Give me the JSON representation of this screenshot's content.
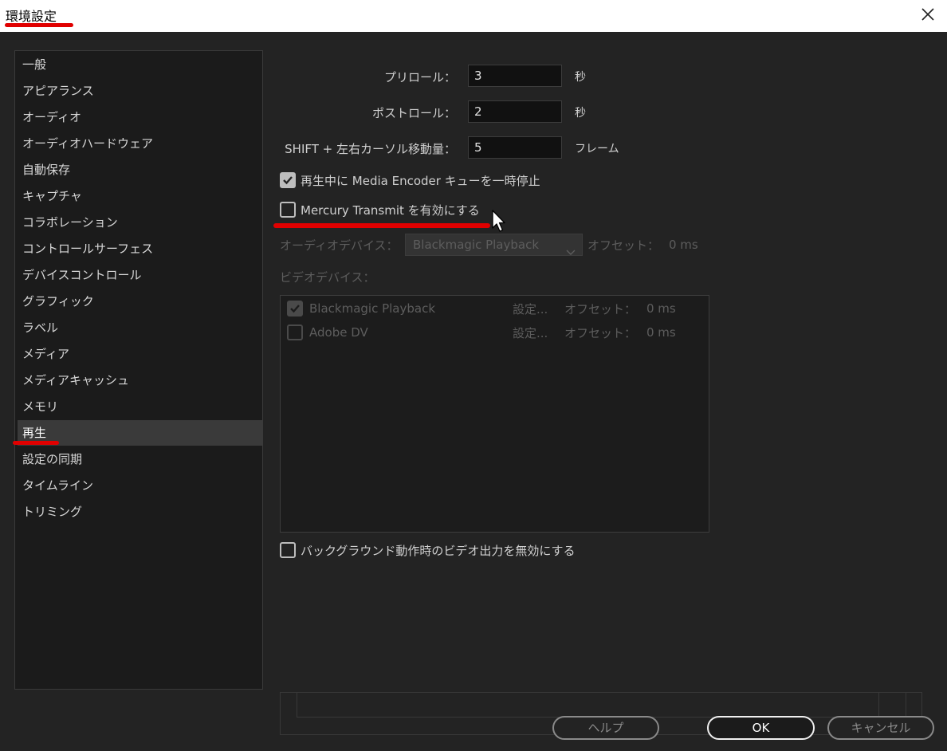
{
  "window": {
    "title": "環境設定",
    "close_icon": "close-icon"
  },
  "sidebar": {
    "items": [
      {
        "label": "一般"
      },
      {
        "label": "アピアランス"
      },
      {
        "label": "オーディオ"
      },
      {
        "label": "オーディオハードウェア"
      },
      {
        "label": "自動保存"
      },
      {
        "label": "キャプチャ"
      },
      {
        "label": "コラボレーション"
      },
      {
        "label": "コントロールサーフェス"
      },
      {
        "label": "デバイスコントロール"
      },
      {
        "label": "グラフィック"
      },
      {
        "label": "ラベル"
      },
      {
        "label": "メディア"
      },
      {
        "label": "メディアキャッシュ"
      },
      {
        "label": "メモリ"
      },
      {
        "label": "再生",
        "selected": true
      },
      {
        "label": "設定の同期"
      },
      {
        "label": "タイムライン"
      },
      {
        "label": "トリミング"
      }
    ]
  },
  "playback": {
    "preroll": {
      "label": "プリロール：",
      "value": "3",
      "unit": "秒"
    },
    "postroll": {
      "label": "ポストロール：",
      "value": "2",
      "unit": "秒"
    },
    "shift_step": {
      "label": "SHIFT + 左右カーソル移動量：",
      "value": "5",
      "unit": "フレーム"
    },
    "pause_encoder": {
      "label": "再生中に Media Encoder キューを一時停止",
      "checked": true
    },
    "mercury": {
      "label": "Mercury Transmit を有効にする",
      "checked": false
    },
    "audio_device": {
      "label": "オーディオデバイス：",
      "selected": "Blackmagic Playback",
      "offset_label": "オフセット：",
      "offset_value": "0 ms"
    },
    "video_devices": {
      "label": "ビデオデバイス：",
      "items": [
        {
          "name": "Blackmagic Playback",
          "checked": true,
          "settings": "設定...",
          "offset_label": "オフセット：",
          "offset_value": "0 ms"
        },
        {
          "name": "Adobe DV",
          "checked": false,
          "settings": "設定...",
          "offset_label": "オフセット：",
          "offset_value": "0 ms"
        }
      ]
    },
    "disable_bg": {
      "label": "バックグラウンド動作時のビデオ出力を無効にする",
      "checked": false
    }
  },
  "buttons": {
    "help": "ヘルプ",
    "ok": "OK",
    "cancel": "キャンセル"
  },
  "colors": {
    "annotation_red": "#e00000",
    "panel_bg": "#232323",
    "sidebar_bg": "#1b1b1b",
    "selected_bg": "#3a3a3a"
  }
}
